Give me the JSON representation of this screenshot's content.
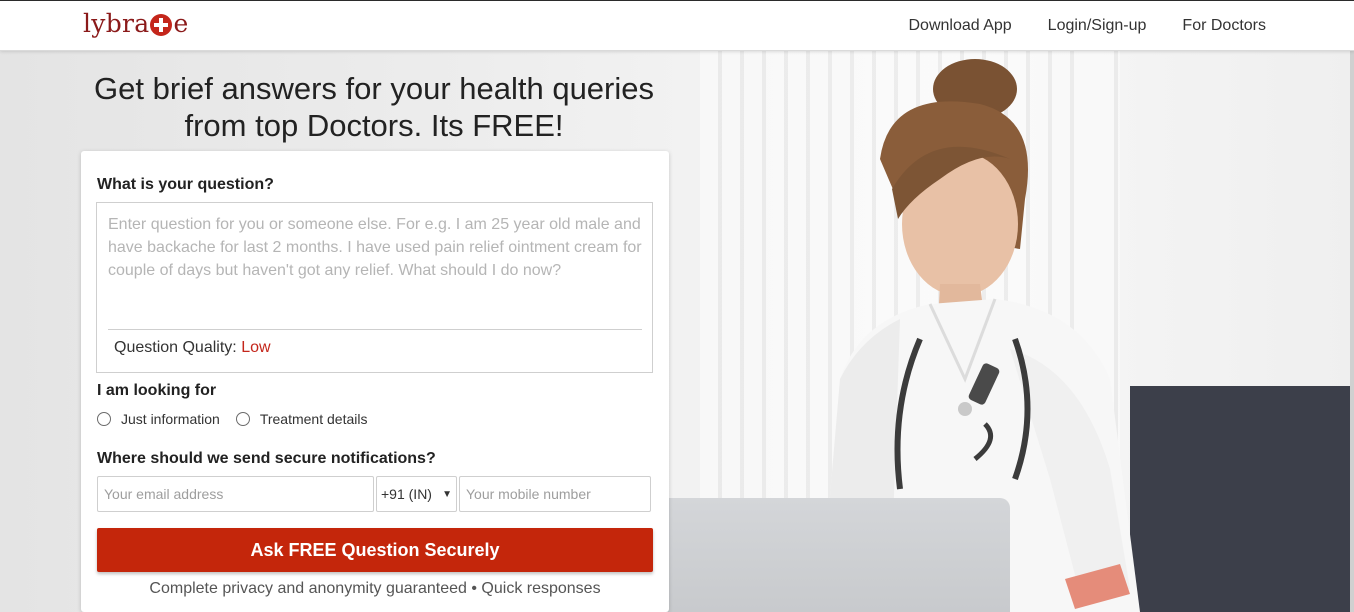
{
  "brand": {
    "logo_text_left": "lybra",
    "logo_text_right": "e",
    "logo_icon": "plus-circle-icon",
    "accent_color": "#c4261b"
  },
  "nav": {
    "items": [
      {
        "label": "Download App"
      },
      {
        "label": "Login/Sign-up"
      },
      {
        "label": "For Doctors"
      }
    ]
  },
  "hero": {
    "headline_line1": "Get brief answers for your health queries",
    "headline_line2": "from top Doctors. Its FREE!"
  },
  "form": {
    "question_label": "What is your question?",
    "question_placeholder": "Enter question for you or someone else. For e.g. I am 25 year old male and have backache for last 2 months. I have used pain relief ointment cream for couple of days but haven't got any relief. What should I do now?",
    "question_value": "",
    "quality_label": "Question Quality:",
    "quality_value": "Low",
    "looking_label": "I am looking for",
    "looking_options": [
      {
        "label": "Just information",
        "selected": false
      },
      {
        "label": "Treatment details",
        "selected": false
      }
    ],
    "notify_label": "Where should we send secure notifications?",
    "email_placeholder": "Your email address",
    "country_code": "+91 (IN)",
    "mobile_placeholder": "Your mobile number",
    "submit_label": "Ask FREE Question Securely",
    "privacy_note": "Complete privacy and anonymity guaranteed • Quick responses"
  }
}
